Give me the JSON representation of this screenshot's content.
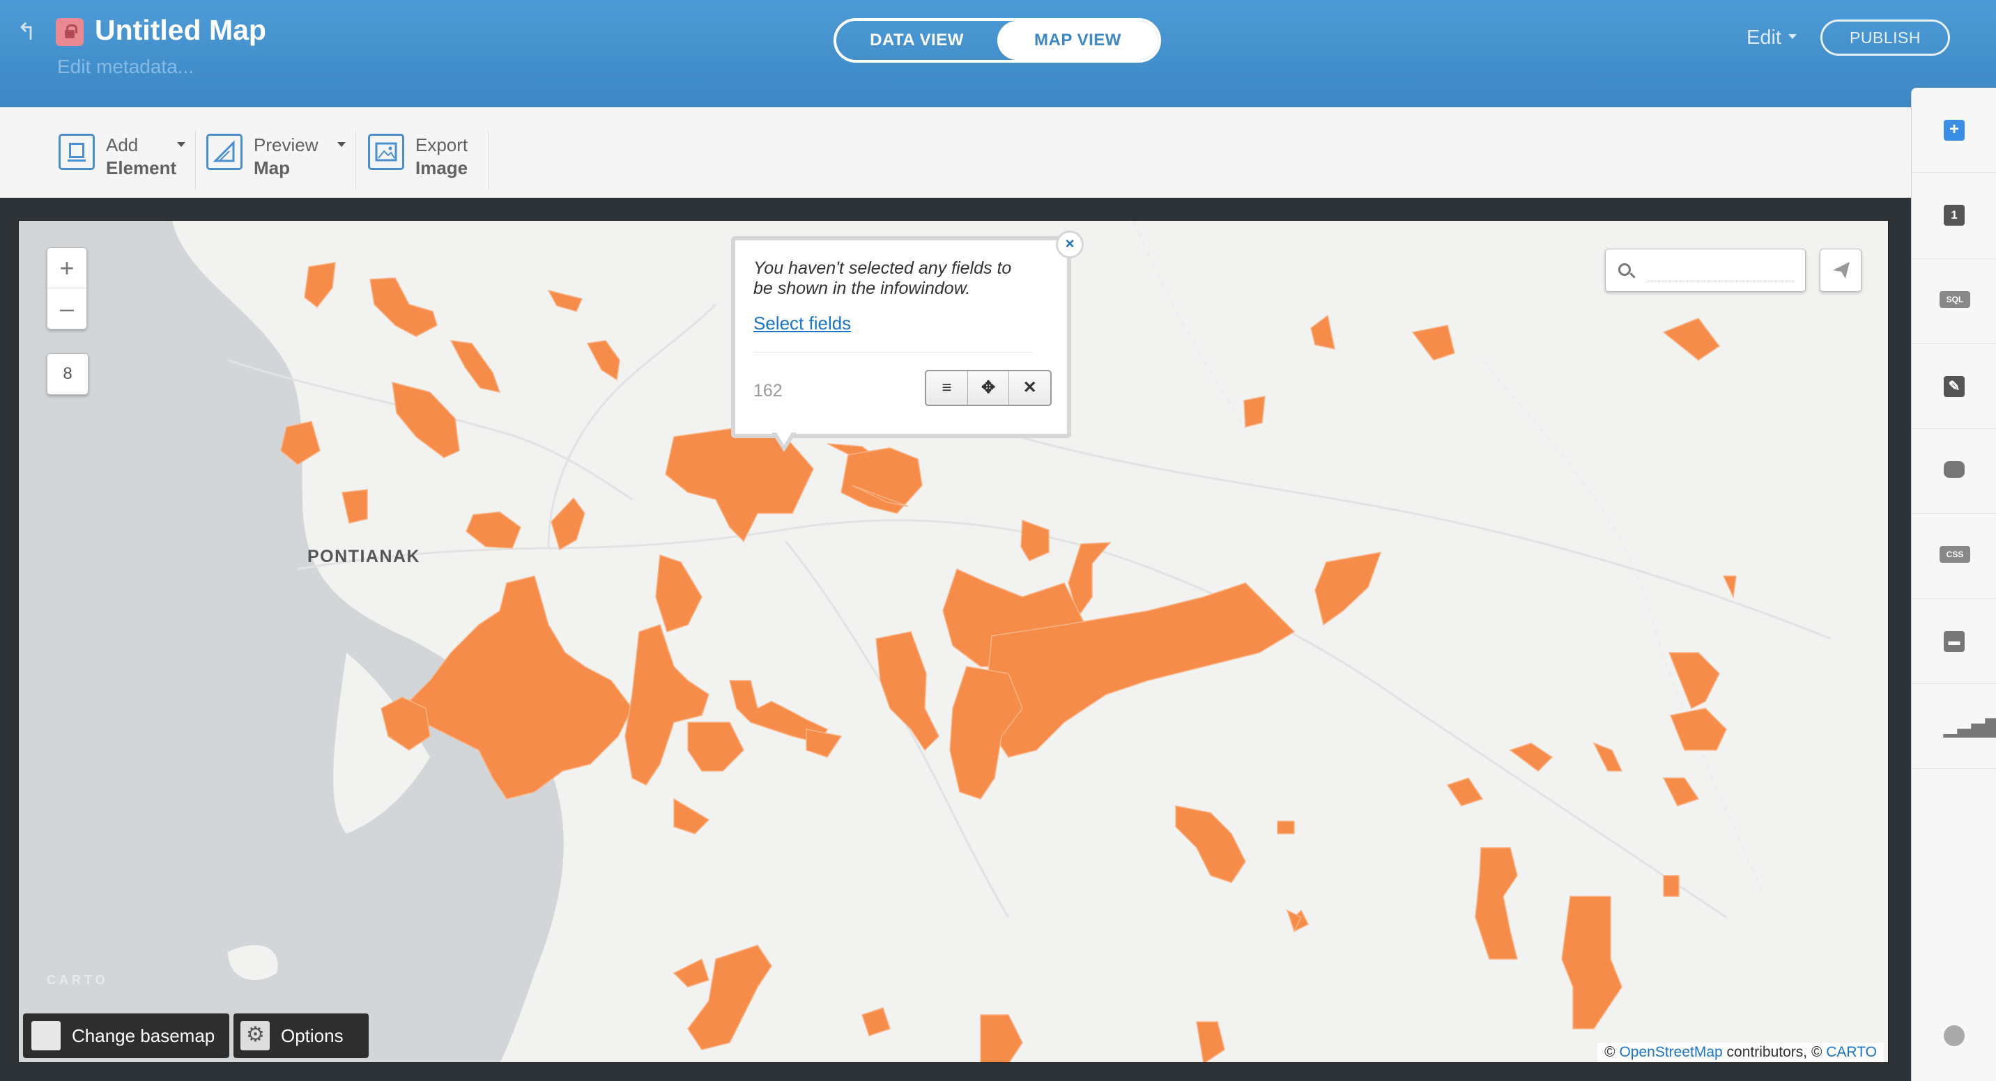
{
  "header": {
    "title": "Untitled Map",
    "edit_metadata": "Edit metadata...",
    "tabs": [
      {
        "label": "DATA VIEW"
      },
      {
        "label": "MAP VIEW"
      }
    ],
    "active_tab": "MAP VIEW",
    "edit_menu": "Edit",
    "publish": "PUBLISH"
  },
  "toolbar": {
    "add_element": {
      "line1": "Add",
      "line2": "Element"
    },
    "preview_map": {
      "line1": "Preview",
      "line2": "Map"
    },
    "export_image": {
      "line1": "Export",
      "line2": "Image"
    }
  },
  "sidebar": {
    "items": [
      {
        "icon": "add-layer-icon"
      },
      {
        "icon": "layer-1-icon",
        "label": "1"
      },
      {
        "icon": "sql-icon",
        "label": "SQL"
      },
      {
        "icon": "wizard-icon"
      },
      {
        "icon": "infowindow-icon"
      },
      {
        "icon": "css-icon",
        "label": "CSS"
      },
      {
        "icon": "legend-icon"
      },
      {
        "icon": "filters-icon"
      },
      {
        "icon": "lightbulb-icon"
      }
    ]
  },
  "map": {
    "zoom_in": "+",
    "zoom_out": "–",
    "zoom_level": "8",
    "city_label": "PONTIANAK",
    "carto_logo": "CARTO",
    "change_basemap": "Change basemap",
    "options": "Options",
    "attribution": {
      "prefix": "© ",
      "osm": "OpenStreetMap",
      "middle": " contributors, © ",
      "carto": "CARTO"
    },
    "polygon_color": "#f68c4a",
    "search_placeholder": ""
  },
  "infowindow": {
    "message": "You haven't selected any fields to be shown in the infowindow.",
    "link": "Select fields",
    "value": "162",
    "buttons": [
      "≡",
      "✥",
      "✕"
    ],
    "close": "×"
  }
}
